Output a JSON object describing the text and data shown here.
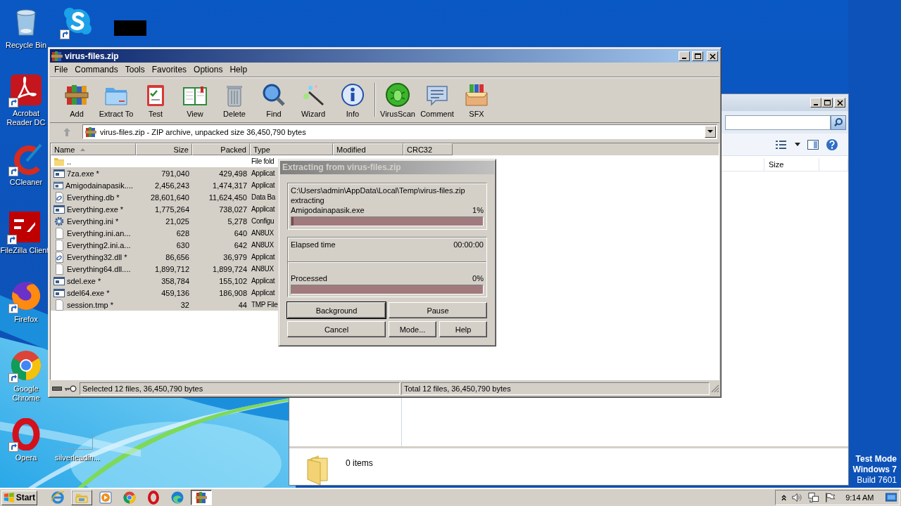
{
  "desktop_icons": [
    {
      "label": "Recycle Bin",
      "shortcut": false
    },
    {
      "shortcut": true
    },
    {
      "shortcut": false
    },
    {
      "label": "Acrobat Reader DC",
      "shortcut": true
    },
    {
      "label": "CCleaner",
      "shortcut": true
    },
    {
      "label": "FileZilla Client",
      "shortcut": true
    },
    {
      "label": "Firefox",
      "shortcut": true
    },
    {
      "label": "Google Chrome",
      "shortcut": true
    },
    {
      "label": "Opera",
      "shortcut": true
    },
    {
      "label": "silverleadin...",
      "shortcut": false
    }
  ],
  "system_notice": {
    "lines": [
      {
        "text": "Test Mode",
        "bold": true
      },
      {
        "text": "Windows 7",
        "bold": true
      },
      {
        "text": "Build 7601",
        "bold": false
      }
    ]
  },
  "explorer": {
    "column_header": "Size",
    "status": "0 items"
  },
  "winrar": {
    "title": "virus-files.zip",
    "menu": [
      "File",
      "Commands",
      "Tools",
      "Favorites",
      "Options",
      "Help"
    ],
    "toolbar_groups": [
      {
        "buttons": [
          "Add",
          "Extract To",
          "Test",
          "View",
          "Delete",
          "Find",
          "Wizard",
          "Info"
        ]
      },
      {
        "buttons": [
          "VirusScan",
          "Comment",
          "SFX"
        ]
      }
    ],
    "address": "virus-files.zip - ZIP archive, unpacked size 36,450,790 bytes",
    "columns": [
      {
        "label": "Name",
        "sorted": true
      },
      {
        "label": "Size",
        "sorted": false
      },
      {
        "label": "Packed",
        "sorted": false
      },
      {
        "label": "Type",
        "sorted": false
      },
      {
        "label": "Modified",
        "sorted": false
      },
      {
        "label": "CRC32",
        "sorted": false
      }
    ],
    "rows": [
      {
        "kind": "folder",
        "name": "..",
        "type": "File fold",
        "selected": false
      },
      {
        "kind": "app",
        "name": "7za.exe *",
        "size": "791,040",
        "packed": "429,498",
        "type": "Applicat",
        "selected": true
      },
      {
        "kind": "app",
        "name": "Amigodainapasik....",
        "size": "2,456,243",
        "packed": "1,474,317",
        "type": "Applicat",
        "selected": true
      },
      {
        "kind": "linked",
        "name": "Everything.db *",
        "size": "28,601,640",
        "packed": "11,624,450",
        "type": "Data Ba",
        "selected": true
      },
      {
        "kind": "app",
        "name": "Everything.exe *",
        "size": "1,775,264",
        "packed": "738,027",
        "type": "Applicat",
        "selected": true
      },
      {
        "kind": "settings",
        "name": "Everything.ini *",
        "size": "21,025",
        "packed": "5,278",
        "type": "Configu",
        "selected": true
      },
      {
        "kind": "blank",
        "name": "Everything.ini.an...",
        "size": "628",
        "packed": "640",
        "type": "AN8UX",
        "selected": true
      },
      {
        "kind": "blank",
        "name": "Everything2.ini.a...",
        "size": "630",
        "packed": "642",
        "type": "AN8UX",
        "selected": true
      },
      {
        "kind": "linked",
        "name": "Everything32.dll *",
        "size": "86,656",
        "packed": "36,979",
        "type": "Applicat",
        "selected": true
      },
      {
        "kind": "blank",
        "name": "Everything64.dll....",
        "size": "1,899,712",
        "packed": "1,899,724",
        "type": "AN8UX",
        "selected": true
      },
      {
        "kind": "app",
        "name": "sdel.exe *",
        "size": "358,784",
        "packed": "155,102",
        "type": "Applicat",
        "selected": true
      },
      {
        "kind": "app",
        "name": "sdel64.exe *",
        "size": "459,136",
        "packed": "186,908",
        "type": "Applicat",
        "selected": true
      },
      {
        "kind": "blank",
        "name": "session.tmp *",
        "size": "32",
        "packed": "44",
        "type": "TMP File",
        "selected": true
      }
    ],
    "status": {
      "selected": "Selected 12 files, 36,450,790 bytes",
      "total": "Total 12 files, 36,450,790 bytes"
    }
  },
  "dialog": {
    "title": "Extracting from virus-files.zip",
    "archive_path": "C:\\Users\\admin\\AppData\\Local\\Temp\\virus-files.zip",
    "action": "extracting",
    "current_file": "Amigodainapasik.exe",
    "file_progress": {
      "reading": "1%",
      "level": 0.01
    },
    "elapsed_label": "Elapsed time",
    "elapsed": "00:00:00",
    "processed_label": "Processed",
    "processed_progress": {
      "reading": "0%",
      "level": 0
    },
    "buttons": [
      {
        "label": "Background",
        "default": true
      },
      {
        "label": "Pause",
        "default": false
      },
      {
        "label": "Cancel",
        "default": false
      },
      {
        "label": "Mode...",
        "default": false
      },
      {
        "label": "Help",
        "default": false
      }
    ]
  },
  "taskbar": {
    "start": "Start",
    "items": [
      {
        "running": false,
        "selected": false
      },
      {
        "running": true,
        "selected": false
      },
      {
        "running": false,
        "selected": false
      },
      {
        "running": false,
        "selected": false
      },
      {
        "running": false,
        "selected": false
      },
      {
        "running": false,
        "selected": false
      },
      {
        "running": true,
        "selected": true
      }
    ],
    "clock": "9:14 AM"
  }
}
